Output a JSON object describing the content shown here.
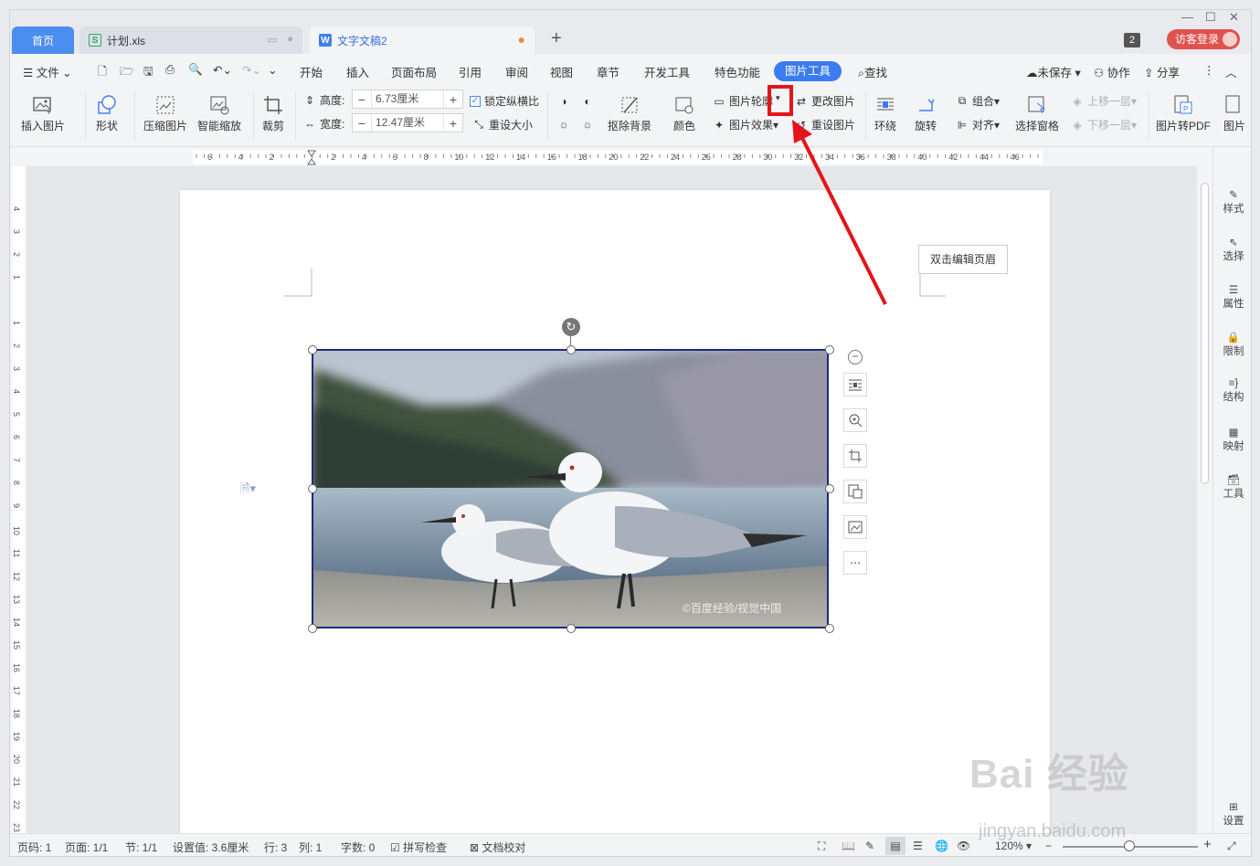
{
  "tabs": {
    "home": "首页",
    "file1": "计划.xls",
    "file2": "文字文稿2",
    "new_tab": "+",
    "count_badge": "2",
    "login": "访客登录"
  },
  "menu": {
    "file": "文件",
    "items": [
      "开始",
      "插入",
      "页面布局",
      "引用",
      "审阅",
      "视图",
      "章节",
      "开发工具",
      "特色功能"
    ],
    "active": "图片工具",
    "search": "查找",
    "unsaved": "未保存",
    "collab": "协作",
    "share": "分享"
  },
  "ribbon": {
    "insert_pic": "插入图片",
    "shape": "形状",
    "compress": "压缩图片",
    "smart_zoom": "智能缩放",
    "crop": "裁剪",
    "height_label": "高度:",
    "height_value": "6.73厘米",
    "width_label": "宽度:",
    "width_value": "12.47厘米",
    "lock_ratio": "锁定纵横比",
    "reset_size": "重设大小",
    "remove_bg": "抠除背景",
    "color": "颜色",
    "pic_outline": "图片轮廓",
    "pic_effect": "图片效果",
    "change_pic": "更改图片",
    "reset_pic": "重设图片",
    "wrap": "环绕",
    "rotate": "旋转",
    "group": "组合",
    "align": "对齐",
    "select_pane": "选择窗格",
    "bring_forward": "上移一层",
    "send_backward": "下移一层",
    "to_pdf": "图片转PDF",
    "pic_more": "图片"
  },
  "doc": {
    "header_tip": "双击编辑页眉",
    "photo_watermark": "©百度经验/视觉中国"
  },
  "right_panel": [
    "样式",
    "选择",
    "属性",
    "限制",
    "结构",
    "映射",
    "工具",
    "设置"
  ],
  "status": {
    "page_code": "页码: 1",
    "pages": "页面: 1/1",
    "section": "节: 1/1",
    "setting": "设置值: 3.6厘米",
    "row": "行: 3",
    "col": "列: 1",
    "words": "字数: 0",
    "spell": "拼写检查",
    "proof": "文档校对",
    "zoom": "120%"
  },
  "watermark": {
    "brand": "Bai 经验",
    "url": "jingyan.baidu.com"
  }
}
